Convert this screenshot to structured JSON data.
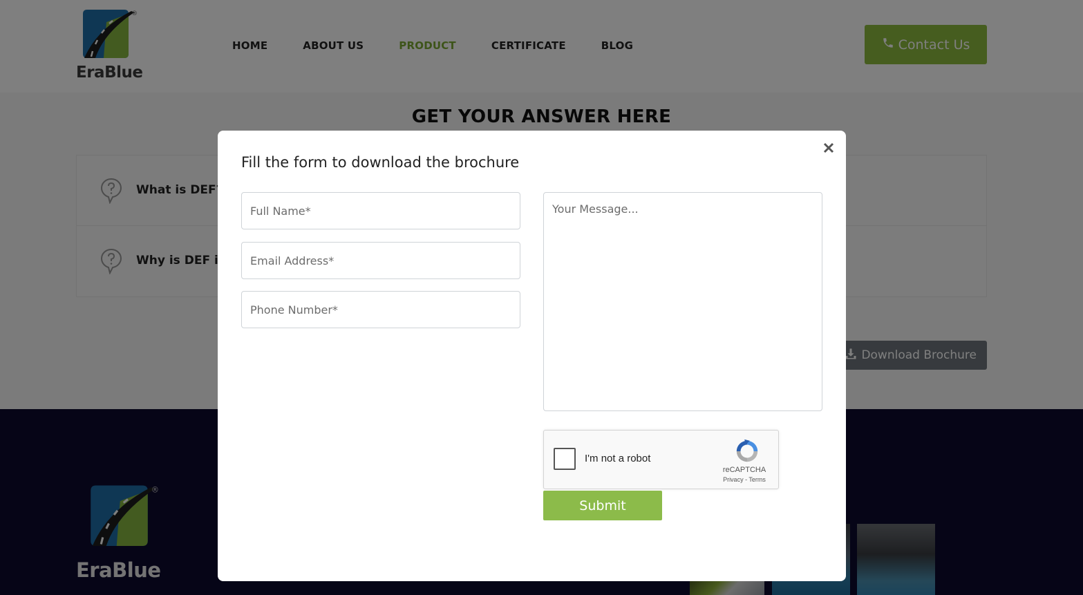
{
  "brand": {
    "name": "EraBlue",
    "registered": "®"
  },
  "nav": {
    "items": [
      {
        "label": "HOME",
        "active": false
      },
      {
        "label": "ABOUT US",
        "active": false
      },
      {
        "label": "PRODUCT",
        "active": true
      },
      {
        "label": "CERTIFICATE",
        "active": false
      },
      {
        "label": "BLOG",
        "active": false
      }
    ],
    "contact_label": "Contact Us",
    "contact_icon": "phone-icon"
  },
  "section": {
    "title": "GET YOUR ANSWER HERE",
    "faq": [
      {
        "question": "What is DEF?",
        "icon": "question-bubble-icon"
      },
      {
        "question": "Why is DEF in",
        "icon": "question-bubble-icon"
      }
    ],
    "download_label": "Download Brochure",
    "download_icon": "download-icon"
  },
  "modal": {
    "title": "Fill the form to download the brochure",
    "close_icon": "close-icon",
    "fields": {
      "full_name_placeholder": "Full Name*",
      "email_placeholder": "Email Address*",
      "phone_placeholder": "Phone Number*",
      "message_placeholder": "Your Message..."
    },
    "captcha": {
      "label": "I'm not a robot",
      "brand": "reCAPTCHA",
      "privacy": "Privacy",
      "separator": " - ",
      "terms": "Terms"
    },
    "submit_label": "Submit"
  },
  "colors": {
    "accent": "#8cbb3f",
    "nav_active": "#7aa832",
    "footer_bg": "#0c0b2e",
    "download_btn": "#6e757c"
  }
}
